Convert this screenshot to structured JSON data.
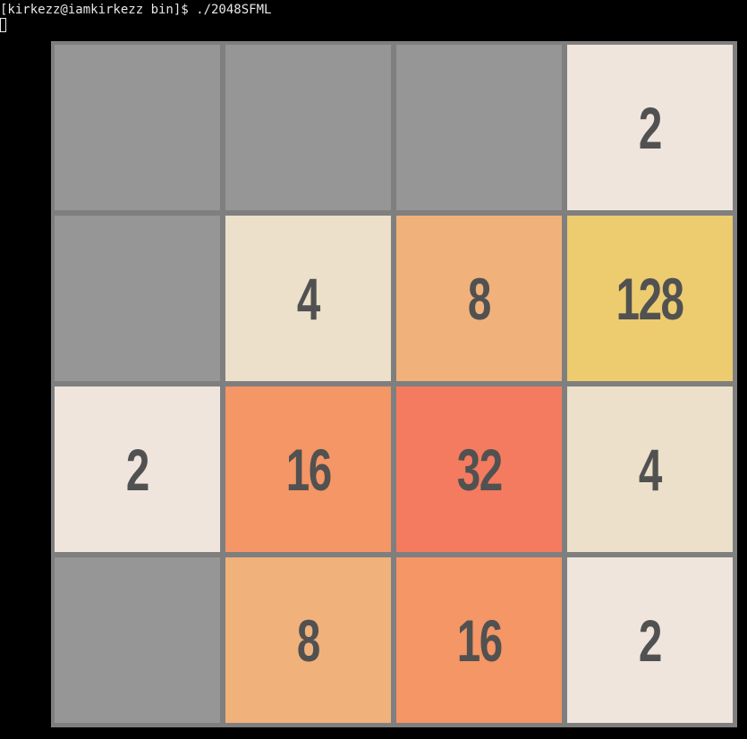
{
  "terminal": {
    "prompt_line": "[kirkezz@iamkirkezz bin]$ ./2048SFML"
  },
  "colors": {
    "background": "#000000",
    "board": "#7f7f7f",
    "empty": "#969696",
    "text": "#515151",
    "tile_2": "#efe5dd",
    "tile_4": "#ece0ca",
    "tile_8": "#f1b17a",
    "tile_16": "#f49665",
    "tile_32": "#f47b5f",
    "tile_128": "#edcc6f"
  },
  "board": {
    "rows": [
      [
        "",
        "",
        "",
        "2"
      ],
      [
        "",
        "4",
        "8",
        "128"
      ],
      [
        "2",
        "16",
        "32",
        "4"
      ],
      [
        "",
        "8",
        "16",
        "2"
      ]
    ]
  }
}
